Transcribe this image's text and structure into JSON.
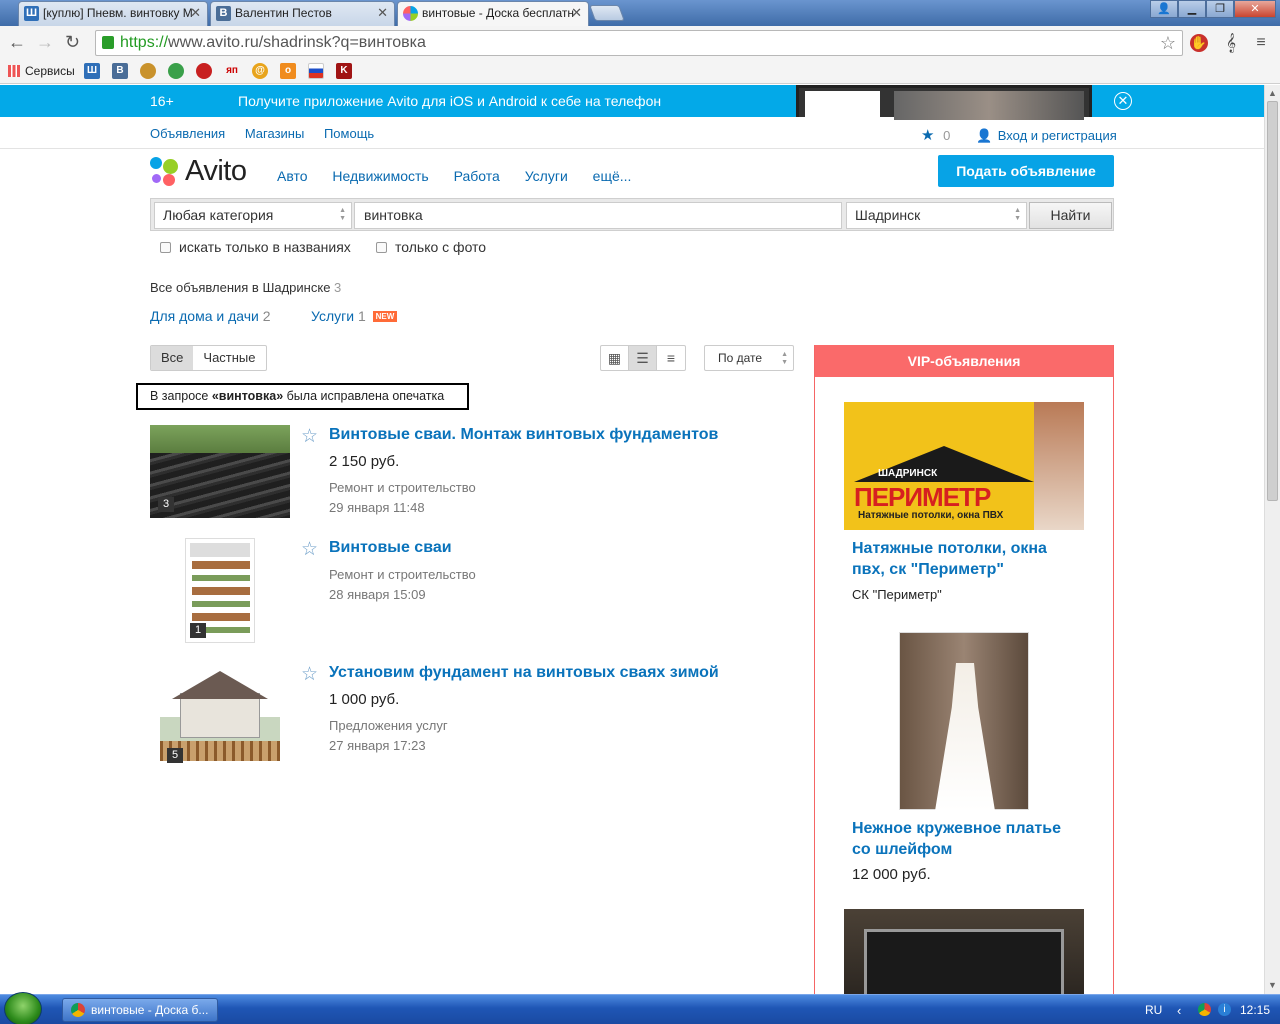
{
  "browser": {
    "tabs": [
      {
        "title": "[куплю] Пневм. винтовку М",
        "favicon": "Ш"
      },
      {
        "title": "Валентин Пестов",
        "favicon": "В"
      },
      {
        "title": "винтовые - Доска бесплатн",
        "favicon": ""
      }
    ],
    "url_scheme": "https://",
    "url_rest": "www.avito.ru/shadrinsk?q=винтовка",
    "bookmarks_apps_label": "Сервисы"
  },
  "promo": {
    "age": "16+",
    "message": "Получите приложение Avito для iOS и Android к себе на телефон"
  },
  "topnav": {
    "links": [
      "Объявления",
      "Магазины",
      "Помощь"
    ],
    "favorites_count": "0",
    "login": "Вход и регистрация"
  },
  "header": {
    "logo": "Avito",
    "nav": [
      "Авто",
      "Недвижимость",
      "Работа",
      "Услуги",
      "ещё..."
    ],
    "post_button": "Подать объявление"
  },
  "search": {
    "category": "Любая категория",
    "query": "винтовка",
    "city": "Шадринск",
    "find_button": "Найти",
    "only_titles": "искать только в названиях",
    "only_photo": "только с фото"
  },
  "results": {
    "all_ads_label": "Все объявления в Шадринске",
    "all_ads_count": "3",
    "categories": [
      {
        "label": "Для дома и дачи",
        "count": "2"
      },
      {
        "label": "Услуги",
        "count": "1",
        "badge": "NEW"
      }
    ],
    "filter_all": "Все",
    "filter_private": "Частные",
    "sort": "По дате",
    "notice_pre": "В запросе ",
    "notice_word": "«винтовка»",
    "notice_post": " была исправлена опечатка"
  },
  "ads": [
    {
      "title": "Винтовые сваи. Монтаж винтовых фундаментов",
      "price": "2 150 руб.",
      "category": "Ремонт и строительство",
      "date": "29 января 11:48",
      "photos": "3"
    },
    {
      "title": "Винтовые сваи",
      "price": "",
      "category": "Ремонт и строительство",
      "date": "28 января 15:09",
      "photos": "1"
    },
    {
      "title": "Установим фундамент на винтовых сваях зимой",
      "price": "1 000 руб.",
      "category": "Предложения услуг",
      "date": "27 января 17:23",
      "photos": "5"
    }
  ],
  "vip": {
    "header": "VIP-объявления",
    "items": [
      {
        "title": "Натяжные потолки, окна пвх, ск \"Периметр\"",
        "sub": "СК \"Периметр\"",
        "banner_city": "ШАДРИНСК",
        "banner_brand": "ПЕРИМЕТР",
        "banner_tagline": "Натяжные потолки, окна ПВХ"
      },
      {
        "title": "Нежное кружевное платье со шлейфом",
        "price": "12 000 руб."
      }
    ]
  },
  "taskbar": {
    "item": "винтовые - Доска б...",
    "lang": "RU",
    "time": "12:15"
  },
  "colors": {
    "avito_blue": "#07a3e6",
    "link": "#0a6ab0",
    "vip_red": "#fa6a6a"
  }
}
